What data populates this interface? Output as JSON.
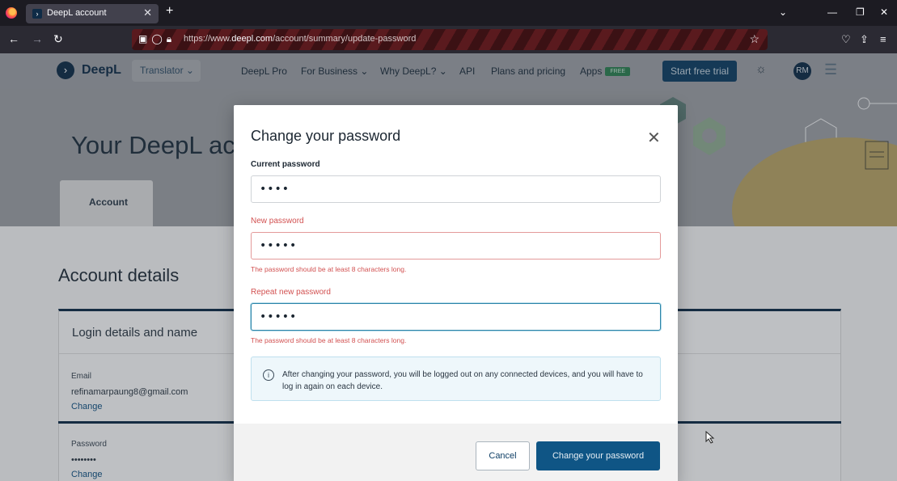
{
  "browser": {
    "tab_title": "DeepL account",
    "tab_favicon": "›",
    "url_prefix": "https://www.",
    "url_domain": "deepl.com",
    "url_path": "/account/summary/update-password"
  },
  "site": {
    "logo_text": "DeepL",
    "translator_label": "Translator",
    "nav": [
      "DeepL Pro",
      "For Business",
      "Why DeepL?",
      "API",
      "Plans and pricing",
      "Apps"
    ],
    "free_badge": "FREE",
    "trial_label": "Start free trial",
    "avatar_initials": "RM"
  },
  "hero": {
    "title": "Your DeepL acco",
    "tab_label": "Account"
  },
  "account": {
    "section_title": "Account details",
    "card_title": "Login details and name",
    "email_label": "Email",
    "email_value": "refinamarpaung8@gmail.com",
    "email_change": "Change",
    "password_label": "Password",
    "password_value": "••••••••",
    "password_change": "Change"
  },
  "modal": {
    "title": "Change your password",
    "current_label": "Current password",
    "current_value": "••••",
    "new_label": "New password",
    "new_value": "•••••",
    "new_error": "The password should be at least 8 characters long.",
    "repeat_label": "Repeat new password",
    "repeat_value": "•••••",
    "repeat_error": "The password should be at least 8 characters long.",
    "info_text": "After changing your password, you will be logged out on any connected devices, and you will have to log in again on each device.",
    "cancel_label": "Cancel",
    "submit_label": "Change your password"
  },
  "colors": {
    "brand": "#0f2b46",
    "error": "#d25151",
    "primary_button": "#0f5585"
  }
}
